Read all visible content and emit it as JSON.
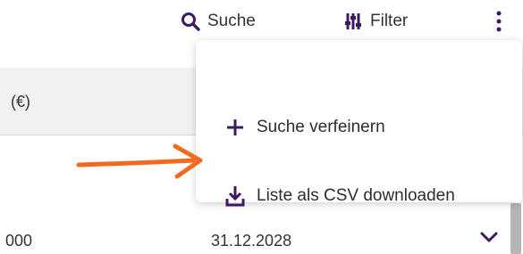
{
  "toolbar": {
    "search_label": "Suche",
    "filter_label": "Filter"
  },
  "table": {
    "header_partial": "(€)",
    "row": {
      "amount_partial": "000",
      "date": "31.12.2028"
    }
  },
  "menu": {
    "items": [
      {
        "label": "Suche verfeinern",
        "icon": "plus-icon"
      },
      {
        "label": "Liste als CSV downloaden",
        "icon": "download-icon"
      }
    ]
  },
  "colors": {
    "accent": "#3c1a63",
    "annotation_arrow": "#f26a22"
  }
}
